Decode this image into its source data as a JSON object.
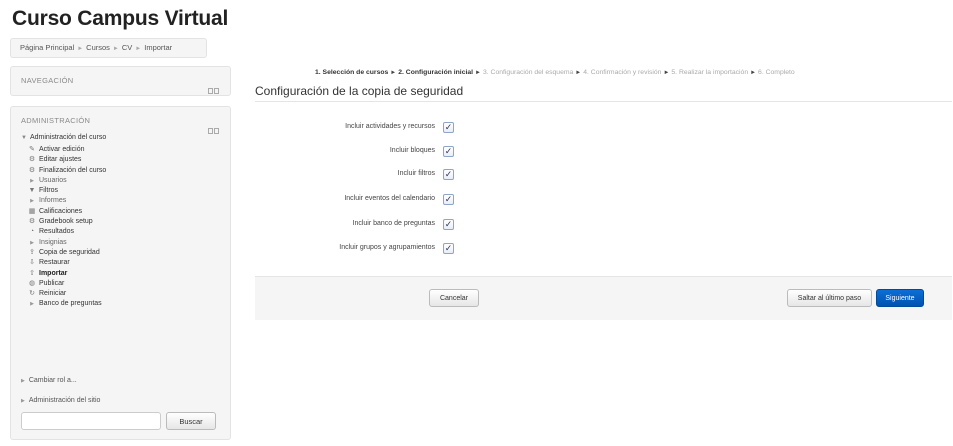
{
  "site": {
    "title": "Curso Campus Virtual"
  },
  "breadcrumb": {
    "items": [
      "Página Principal",
      "Cursos",
      "CV",
      "Importar"
    ]
  },
  "navigation": {
    "title": "NAVEGACIÓN"
  },
  "administration": {
    "title": "ADMINISTRACIÓN",
    "course_admin": "Administración del curso",
    "items": [
      {
        "label": "Activar edición",
        "icon": "pencil-icon"
      },
      {
        "label": "Editar ajustes",
        "icon": "gear-icon"
      },
      {
        "label": "Finalización del curso",
        "icon": "gear-icon"
      },
      {
        "label": "Usuarios",
        "icon": "triangle-right-icon"
      },
      {
        "label": "Filtros",
        "icon": "filter-icon"
      },
      {
        "label": "Informes",
        "icon": "triangle-right-icon"
      },
      {
        "label": "Calificaciones",
        "icon": "table-icon"
      },
      {
        "label": "Gradebook setup",
        "icon": "gear-icon"
      },
      {
        "label": "Resultados",
        "icon": "pie-icon"
      },
      {
        "label": "Insignias",
        "icon": "triangle-right-icon"
      },
      {
        "label": "Copia de seguridad",
        "icon": "backup-icon"
      },
      {
        "label": "Restaurar",
        "icon": "restore-icon"
      },
      {
        "label": "Importar",
        "icon": "import-icon"
      },
      {
        "label": "Publicar",
        "icon": "publish-icon"
      },
      {
        "label": "Reiniciar",
        "icon": "reset-icon"
      },
      {
        "label": "Banco de preguntas",
        "icon": "triangle-right-icon"
      }
    ],
    "switch_role": "Cambiar rol a...",
    "site_admin": "Administración del sitio",
    "search_button": "Buscar",
    "search_value": ""
  },
  "steps": {
    "items": [
      {
        "label": "1. Selección de cursos",
        "done": true
      },
      {
        "label": "2. Configuración inicial",
        "done": true
      },
      {
        "label": "3. Configuración del esquema",
        "done": false
      },
      {
        "label": "4. Confirmación y revisión",
        "done": false
      },
      {
        "label": "5. Realizar la importación",
        "done": false
      },
      {
        "label": "6. Completo",
        "done": false
      }
    ]
  },
  "main": {
    "title": "Configuración de la copia de seguridad",
    "options": [
      {
        "label": "Incluir actividades y recursos",
        "checked": true
      },
      {
        "label": "Incluir bloques",
        "checked": true
      },
      {
        "label": "Incluir filtros",
        "checked": true
      },
      {
        "label": "Incluir eventos del calendario",
        "checked": true
      },
      {
        "label": "Incluir banco de preguntas",
        "checked": true
      },
      {
        "label": "Incluir grupos y agrupamientos",
        "checked": true
      }
    ],
    "cancel_button": "Cancelar",
    "skip_button": "Saltar al último paso",
    "next_button": "Siguiente"
  },
  "colors": {
    "primary": "#0a63c9",
    "link": "#333333"
  }
}
